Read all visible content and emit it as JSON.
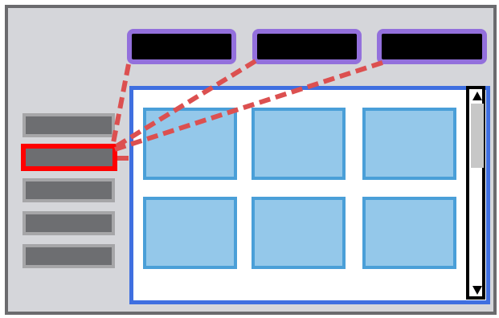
{
  "window": {
    "label": ""
  },
  "tabs": [
    {
      "label": ""
    },
    {
      "label": ""
    },
    {
      "label": ""
    }
  ],
  "sidebar": {
    "items": [
      {
        "label": "",
        "selected": false
      },
      {
        "label": "",
        "selected": true
      },
      {
        "label": "",
        "selected": false
      },
      {
        "label": "",
        "selected": false
      },
      {
        "label": "",
        "selected": false
      }
    ]
  },
  "content": {
    "tiles": [
      {
        "label": ""
      },
      {
        "label": ""
      },
      {
        "label": ""
      },
      {
        "label": ""
      },
      {
        "label": ""
      },
      {
        "label": ""
      }
    ]
  },
  "colors": {
    "frame_bg": "#d5d6da",
    "frame_border": "#6b6b6e",
    "tab_fill": "#000000",
    "tab_border": "#9370dc",
    "sidebar_item": "#6d6e71",
    "selected_border": "#ff0000",
    "panel_border": "#3f6fe0",
    "tile_fill": "#94c8ea",
    "tile_border": "#4a9fd8",
    "connector": "#dc5050"
  },
  "icons": {
    "scroll_up": "triangle-up-icon",
    "scroll_down": "triangle-down-icon"
  }
}
